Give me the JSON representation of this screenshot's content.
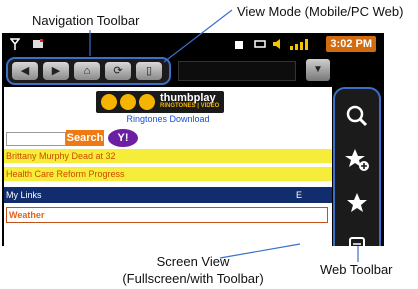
{
  "callouts": {
    "navigation_toolbar": "Navigation Toolbar",
    "view_mode": "View Mode (Mobile/PC Web)",
    "screen_view_line1": "Screen View",
    "screen_view_line2": "(Fullscreen/with Toolbar)",
    "web_toolbar": "Web Toolbar"
  },
  "status_bar": {
    "time": "3:02 PM"
  },
  "nav_toolbar": {
    "buttons": [
      "back-icon",
      "forward-icon",
      "home-icon",
      "refresh-icon",
      "view-mode-icon"
    ],
    "back_glyph": "◀",
    "forward_glyph": "▶",
    "home_glyph": "⌂",
    "refresh_glyph": "⟳",
    "view_mode_glyph": "▯"
  },
  "url_dropdown_glyph": "▼",
  "page": {
    "banner_brand": "thumbplay",
    "banner_sub": "RINGTONES | VIDEO",
    "ringtones_link": "Ringtones Download",
    "search_button": "Search",
    "yahoo_logo": "Y!",
    "news": [
      "Brittany Murphy Dead at 32",
      "Health Care Reform Progress"
    ],
    "my_links": "My Links",
    "my_links_right": "E",
    "weather": "Weather"
  },
  "web_toolbar": {
    "buttons": [
      "search-icon",
      "add-bookmark-icon",
      "bookmark-star-icon",
      "menu-list-icon"
    ]
  },
  "colors": {
    "accent_blue": "#3b6fc8",
    "clock_orange": "#d26a10",
    "search_orange": "#f07a12",
    "yellow_row": "#f6ec3a",
    "my_links_bar": "#122d6e",
    "yahoo_purple": "#6d1fa3"
  }
}
